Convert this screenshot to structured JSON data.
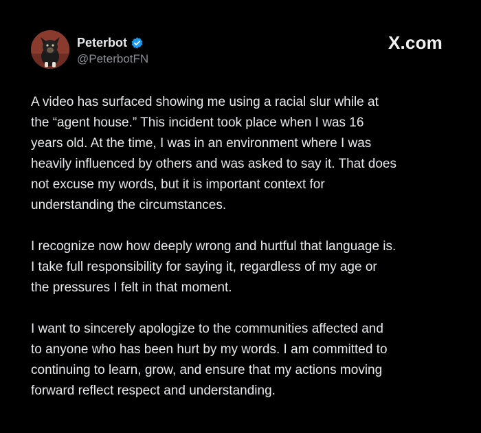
{
  "author": {
    "display_name": "Peterbot",
    "handle": "@PeterbotFN",
    "verified": true,
    "avatar_icon": "dog-avatar",
    "verified_icon": "verified-badge-icon",
    "verified_color": "#1d9bf0"
  },
  "brand": {
    "label": "X.com"
  },
  "post": {
    "paragraphs": [
      "A video has surfaced showing me using a racial slur while at\nthe “agent house.” This incident took place when I was 16\nyears old. At the time, I was in an environment where I was\nheavily influenced by others and was asked to say it. That does\nnot excuse my words, but it is important context for\nunderstanding the circumstances.",
      "I recognize now how deeply wrong and hurtful that language is.\nI take full responsibility for saying it, regardless of my age or\nthe pressures I felt in that moment.",
      "I want to sincerely apologize to the communities affected and\nto anyone who has been hurt by my words. I am committed to\ncontinuing to learn, grow, and ensure that my actions moving\nforward reflect respect and understanding."
    ]
  },
  "colors": {
    "background": "#000000",
    "text": "#e7e9ea",
    "secondary_text": "#8b8f94"
  }
}
